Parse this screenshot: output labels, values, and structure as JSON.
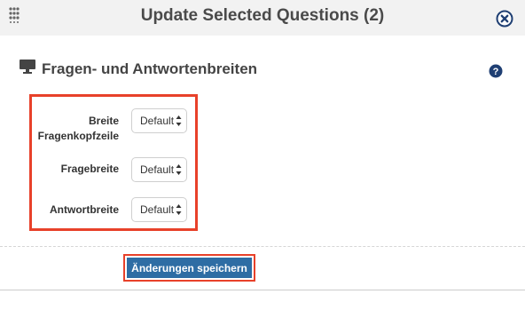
{
  "dialog": {
    "title": "Update Selected Questions (2)",
    "icons": {
      "drag": "drag-handle-icon",
      "close": "close-circle-icon",
      "help": "help-circle-icon",
      "monitor": "monitor-icon"
    }
  },
  "section": {
    "title": "Fragen- und Antwortenbreiten"
  },
  "form": {
    "rows": [
      {
        "label_line1": "Breite",
        "label_line2": "Fragenkopfzeile",
        "value": "Default"
      },
      {
        "label": "Fragebreite",
        "value": "Default"
      },
      {
        "label": "Antwortbreite",
        "value": "Default"
      }
    ]
  },
  "actions": {
    "save_label": "Änderungen speichern"
  },
  "colors": {
    "accent": "#2e6da4",
    "highlight": "#e8412a",
    "header_bg": "#f2f2f2",
    "icon": "#1f3f73"
  }
}
